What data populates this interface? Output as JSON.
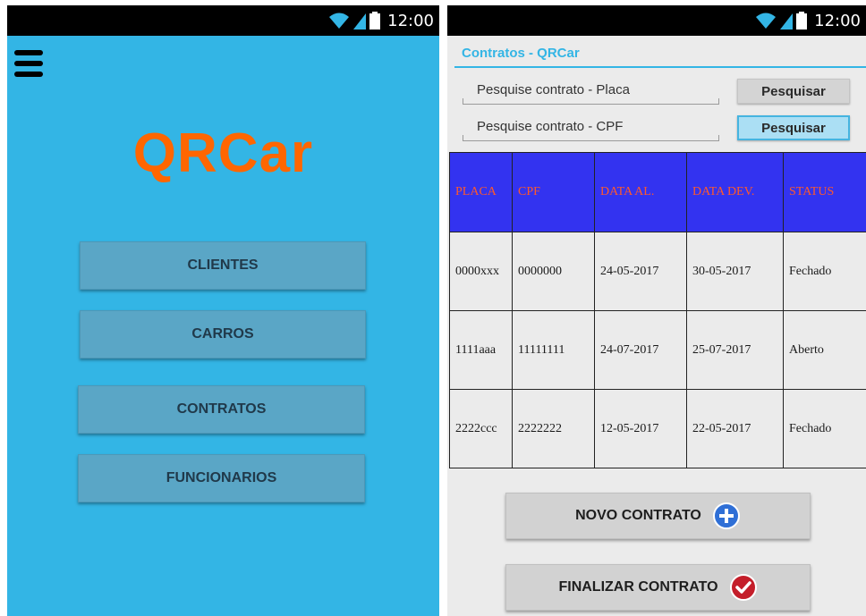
{
  "status_bar": {
    "time": "12:00",
    "icons": [
      "wifi-icon",
      "signal-icon",
      "battery-icon"
    ]
  },
  "menu_screen": {
    "app_name": "QRCar",
    "menu_icon": "hamburger-menu-icon",
    "buttons": {
      "clientes": "CLIENTES",
      "carros": "CARROS",
      "contratos": "CONTRATOS",
      "funcionarios": "FUNCIONARIOS"
    }
  },
  "contracts_screen": {
    "title": "Contratos - QRCar",
    "search_placa": {
      "placeholder": "Pesquise contrato - Placa",
      "button": "Pesquisar"
    },
    "search_cpf": {
      "placeholder": "Pesquise contrato - CPF",
      "button": "Pesquisar"
    },
    "table": {
      "headers": [
        "PLACA",
        "CPF",
        "DATA AL.",
        "DATA DEV.",
        "STATUS"
      ],
      "rows": [
        [
          "0000xxx",
          "0000000",
          "24-05-2017",
          "30-05-2017",
          "Fechado"
        ],
        [
          "1111aaa",
          "11111111",
          "24-07-2017",
          "25-07-2017",
          "Aberto"
        ],
        [
          "2222ccc",
          "2222222",
          "12-05-2017",
          "22-05-2017",
          "Fechado"
        ]
      ]
    },
    "actions": {
      "novo": "NOVO CONTRATO",
      "novo_icon": "plus-circle-icon",
      "finalizar": "FINALIZAR CONTRATO",
      "finalizar_icon": "checkmark-circle-icon"
    }
  },
  "colors": {
    "accent": "#33b5e5",
    "logo": "#ff6600",
    "table_header_bg": "#3333f0",
    "table_header_text": "#ff5a2a",
    "screen_bg": "#ebebeb"
  }
}
